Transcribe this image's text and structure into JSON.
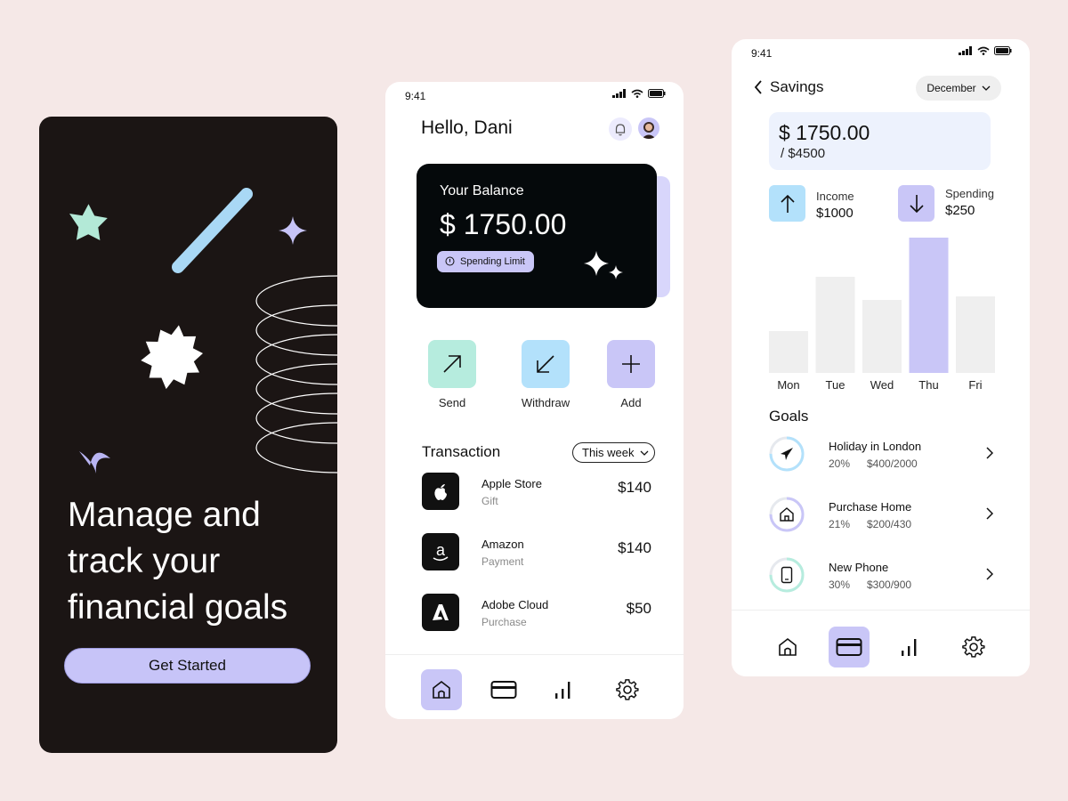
{
  "onboarding": {
    "headline": [
      "Manage and",
      "track your",
      "financial goals"
    ],
    "cta_label": "Get Started",
    "colors": {
      "background": "#1b1514",
      "cta": "#c7c4f8"
    }
  },
  "home": {
    "status_time": "9:41",
    "greeting": "Hello, Dani",
    "balance_label": "Your Balance",
    "balance_amount": "$ 1750.00",
    "spending_limit_label": "Spending Limit",
    "actions": [
      {
        "label": "Send",
        "icon": "arrow-up-right-icon",
        "color": "#b6ecde"
      },
      {
        "label": "Withdraw",
        "icon": "arrow-down-left-icon",
        "color": "#b3e1fb"
      },
      {
        "label": "Add",
        "icon": "plus-icon",
        "color": "#c9c6f7"
      }
    ],
    "transaction_title": "Transaction",
    "filter_label": "This week",
    "transactions": [
      {
        "merchant": "Apple Store",
        "category": "Gift",
        "amount": "$140",
        "icon": "apple-icon"
      },
      {
        "merchant": "Amazon",
        "category": "Payment",
        "amount": "$140",
        "icon": "amazon-icon"
      },
      {
        "merchant": "Adobe Cloud",
        "category": "Purchase",
        "amount": "$50",
        "icon": "adobe-icon"
      }
    ],
    "nav": [
      "home-icon",
      "card-icon",
      "stats-icon",
      "gear-icon"
    ],
    "nav_active": "home-icon"
  },
  "savings": {
    "status_time": "9:41",
    "title": "Savings",
    "month": "December",
    "saved": "$ 1750.00",
    "target": "/ $4500",
    "income_label": "Income",
    "income_value": "$1000",
    "spending_label": "Spending",
    "spending_value": "$250",
    "goals_title": "Goals",
    "goals": [
      {
        "name": "Holiday in London",
        "percent": "20%",
        "progress": "$400/2000",
        "icon": "airplane-icon",
        "fraction": 0.2,
        "color": "#b3e1fb"
      },
      {
        "name": "Purchase Home",
        "percent": "21%",
        "progress": "$200/430",
        "icon": "house-icon",
        "fraction": 0.21,
        "color": "#c9c6f7"
      },
      {
        "name": "New Phone",
        "percent": "30%",
        "progress": "$300/900",
        "icon": "phone-icon",
        "fraction": 0.3,
        "color": "#b6ecde"
      }
    ],
    "nav": [
      "home-icon",
      "card-icon",
      "stats-icon",
      "gear-icon"
    ],
    "nav_active": "card-icon"
  },
  "chart_data": {
    "type": "bar",
    "categories": [
      "Mon",
      "Tue",
      "Wed",
      "Thu",
      "Fri"
    ],
    "values": [
      47,
      108,
      82,
      152,
      86
    ],
    "highlight": "Thu",
    "colors": {
      "bar": "#efefef",
      "highlight": "#c9c6f7"
    },
    "grid": false,
    "title": "",
    "xlabel": "",
    "ylabel": ""
  }
}
